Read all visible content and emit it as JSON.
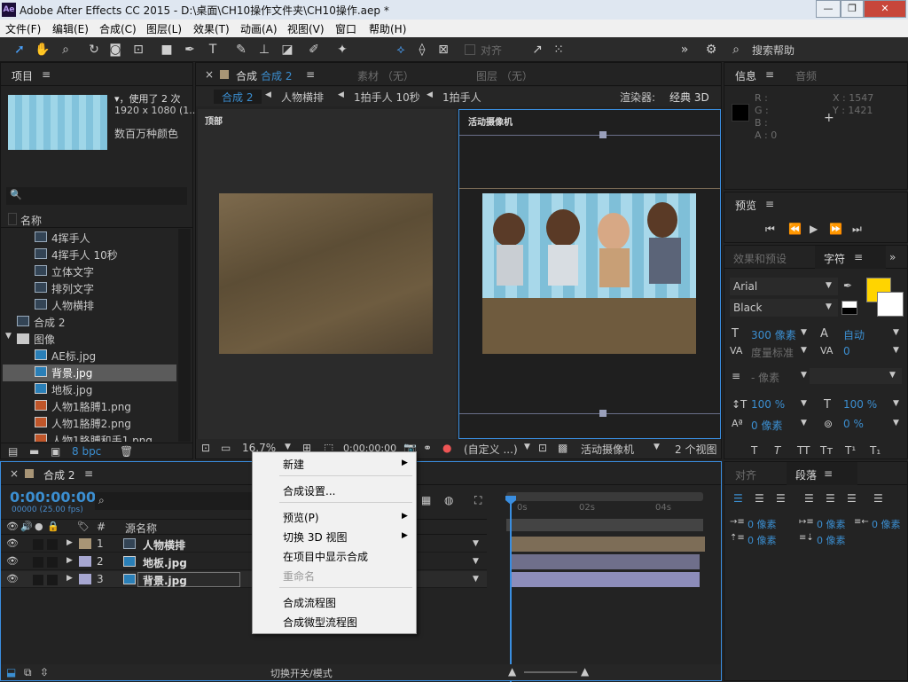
{
  "window": {
    "title": "Adobe After Effects CC 2015 - D:\\桌面\\CH10操作文件夹\\CH10操作.aep *",
    "logo": "Ae"
  },
  "menubar": [
    "文件(F)",
    "编辑(E)",
    "合成(C)",
    "图层(L)",
    "效果(T)",
    "动画(A)",
    "视图(V)",
    "窗口",
    "帮助(H)"
  ],
  "toolbar": {
    "align_label": "对齐",
    "search_label": "搜索帮助"
  },
  "project": {
    "title": "项目",
    "used_text": "▾，使用了 2 次",
    "resolution": "1920 x 1080 (1...",
    "colors": "数百万种颜色",
    "search_icon": "🔍",
    "column_name": "名称",
    "items": [
      {
        "label": "4挥手人",
        "type": "comp",
        "indent": 2
      },
      {
        "label": "4挥手人 10秒",
        "type": "comp",
        "indent": 2
      },
      {
        "label": "立体文字",
        "type": "comp",
        "indent": 2
      },
      {
        "label": "排列文字",
        "type": "comp",
        "indent": 2
      },
      {
        "label": "人物横排",
        "type": "comp",
        "indent": 2
      },
      {
        "label": "合成 2",
        "type": "comp",
        "indent": 1
      },
      {
        "label": "图像",
        "type": "folder",
        "indent": 0
      },
      {
        "label": "AE标.jpg",
        "type": "image",
        "indent": 2
      },
      {
        "label": "背景.jpg",
        "type": "image",
        "indent": 2,
        "selected": true
      },
      {
        "label": "地板.jpg",
        "type": "image",
        "indent": 2
      },
      {
        "label": "人物1胳膊1.png",
        "type": "png",
        "indent": 2
      },
      {
        "label": "人物1胳膊2.png",
        "type": "png",
        "indent": 2
      },
      {
        "label": "人物1胳膊和手1.png",
        "type": "png",
        "indent": 2
      }
    ],
    "bpc": "8 bpc"
  },
  "viewer": {
    "tabs": [
      {
        "label": "合成",
        "sub": "合成 2"
      },
      {
        "label": "素材 （无）"
      },
      {
        "label": "图层 （无）"
      }
    ],
    "breadcrumb": [
      "合成 2",
      "人物横排",
      "1拍手人 10秒",
      "1拍手人"
    ],
    "renderer_label": "渲染器:",
    "renderer_value": "经典 3D",
    "left_view_label": "顶部",
    "right_view_label": "活动摄像机",
    "zoom": "16.7%",
    "timecode": "0:00:00:00",
    "view_custom": "(自定义 ...)",
    "camera": "活动摄像机",
    "views": "2 个视图"
  },
  "info": {
    "tabs": [
      "信息",
      "音频"
    ],
    "r": "R :",
    "g": "G :",
    "b": "B :",
    "a": "A : 0",
    "x": "X : 1547",
    "y": "Y : 1421"
  },
  "preview": {
    "title": "预览"
  },
  "character": {
    "tabs": [
      "效果和预设",
      "字符"
    ],
    "font": "Arial",
    "style": "Black",
    "fill_color": "#ffd400",
    "size": "300 像素",
    "leading": "自动",
    "kerning": "度量标准",
    "tracking": "0",
    "stroke": "- 像素",
    "vscale": "100 %",
    "hscale": "100 %",
    "baseline": "0 像素",
    "tsume": "0 %"
  },
  "paragraph": {
    "tabs": [
      "对齐",
      "段落"
    ],
    "indent_left": "0 像素",
    "indent_first": "0 像素",
    "indent_right": "0 像素",
    "space_before": "0 像素",
    "space_after": "0 像素"
  },
  "timeline": {
    "tab": "合成 2",
    "timecode": "0:00:00:00",
    "fps": "00000 (25.00 fps)",
    "col_source": "源名称",
    "ruler": [
      "0s",
      "02s",
      "04s"
    ],
    "layers": [
      {
        "num": "1",
        "name": "人物横排",
        "color": "#a89576",
        "type": "comp"
      },
      {
        "num": "2",
        "name": "地板.jpg",
        "color": "#a7a7d1",
        "type": "image"
      },
      {
        "num": "3",
        "name": "背景.jpg",
        "color": "#a7a7d1",
        "type": "image"
      }
    ],
    "footer": "切换开关/模式"
  },
  "context_menu": {
    "items": [
      {
        "label": "新建",
        "submenu": true
      },
      {
        "label": "合成设置...",
        "submenu": false
      },
      {
        "label": "预览(P)",
        "submenu": true
      },
      {
        "label": "切换 3D 视图",
        "submenu": true
      },
      {
        "label": "在项目中显示合成",
        "submenu": false
      },
      {
        "label": "重命名",
        "submenu": false,
        "disabled": true
      },
      {
        "label": "合成流程图",
        "submenu": false
      },
      {
        "label": "合成微型流程图",
        "submenu": false
      }
    ]
  }
}
